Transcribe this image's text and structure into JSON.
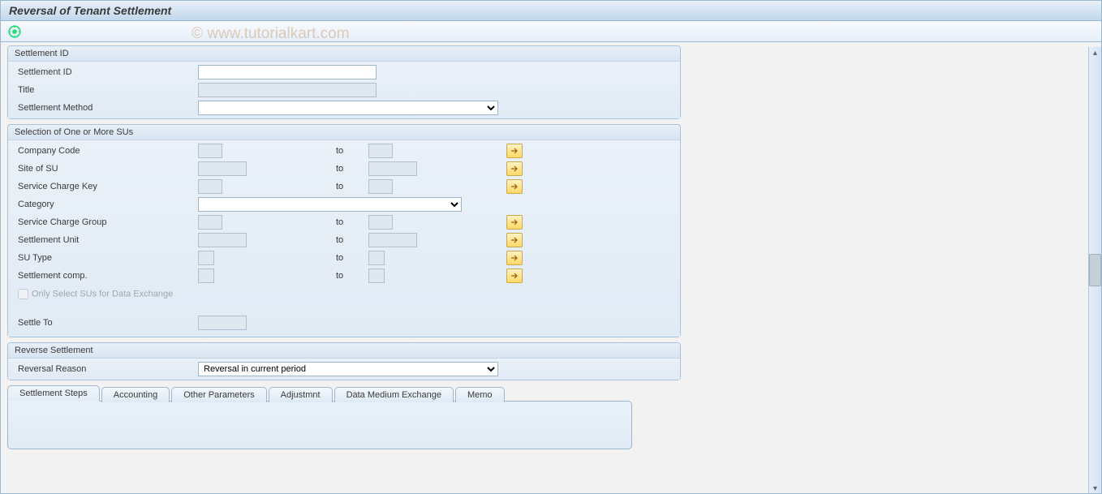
{
  "title": "Reversal of Tenant Settlement",
  "watermark": "© www.tutorialkart.com",
  "grp_settlement_id": {
    "title": "Settlement ID",
    "settlement_id_lbl": "Settlement ID",
    "title_lbl": "Title",
    "method_lbl": "Settlement Method",
    "settlement_id_val": "",
    "title_val": "",
    "method_val": ""
  },
  "grp_su": {
    "title": "Selection of One or More SUs",
    "to_lbl": "to",
    "rows": {
      "company_code": "Company Code",
      "site_of_su": "Site of SU",
      "sc_key": "Service Charge Key",
      "category": "Category",
      "sc_group": "Service Charge Group",
      "settlement_unit": "Settlement Unit",
      "su_type": "SU Type",
      "settlement_comp": "Settlement comp."
    },
    "checkbox_lbl": "Only Select SUs for Data Exchange",
    "settle_to_lbl": "Settle To"
  },
  "grp_reverse": {
    "title": "Reverse Settlement",
    "reason_lbl": "Reversal Reason",
    "reason_val": "Reversal in current period"
  },
  "tabs": {
    "t1": "Settlement Steps",
    "t2": "Accounting",
    "t3": "Other Parameters",
    "t4": "Adjustmnt",
    "t5": "Data Medium Exchange",
    "t6": "Memo"
  }
}
